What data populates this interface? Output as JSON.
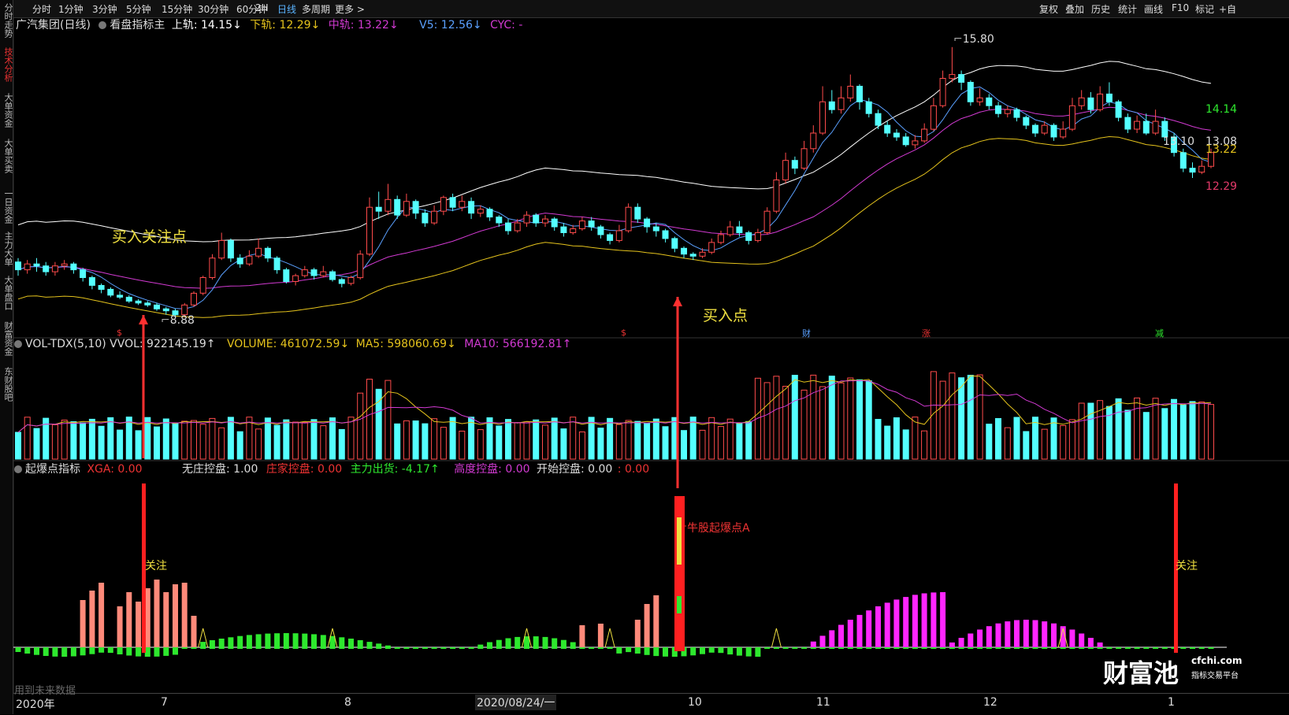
{
  "left_tabs": [
    {
      "label": "分时走势",
      "active": false
    },
    {
      "label": "技术分析",
      "active": true
    },
    {
      "label": "大单资金",
      "active": false
    },
    {
      "label": "大单买卖",
      "active": false
    },
    {
      "label": "一日资金",
      "active": false
    },
    {
      "label": "主力大单",
      "active": false
    },
    {
      "label": "大单盘口",
      "active": false
    },
    {
      "label": "财富资金",
      "active": false
    },
    {
      "label": "东财股吧",
      "active": false
    }
  ],
  "toolbar": {
    "periods": [
      "分时",
      "1分钟",
      "3分钟",
      "5分钟",
      "15分钟",
      "30分钟",
      "60分钟",
      "2H",
      "日线",
      "多周期",
      "更多 >"
    ],
    "active_period": "日线",
    "right": [
      "复权",
      "叠加",
      "历史",
      "统计",
      "画线",
      "F10",
      "标记",
      "+自"
    ]
  },
  "main_header": {
    "stock": "广汽集团(日线)",
    "indicator": "看盘指标主",
    "upper": "上轨: 14.15↓",
    "lower": "下轨: 12.29↓",
    "mid": "中轨: 13.22↓",
    "v5": "V5: 12.56↓",
    "cyc": "CYC: -",
    "colors": {
      "upper": "#ffffff",
      "lower": "#e5c31c",
      "mid": "#d23ad2",
      "v5": "#5aa0ff",
      "cyc": "#d23ad2"
    }
  },
  "vol_header": {
    "name": "VOL-TDX(5,10)",
    "vvol": "VVOL: 922145.19↑",
    "volume": "VOLUME: 461072.59↓",
    "ma5": "MA5: 598060.69↓",
    "ma10": "MA10: 566192.81↑"
  },
  "ind_header": {
    "name": "起爆点指标",
    "xga": "XGA: 0.00",
    "wz": "无庄控盘: 1.00",
    "zj": "庄家控盘: 0.00",
    "zlch": "主力出货: -4.17↑",
    "gd": "高度控盘: 0.00",
    "ks": "开始控盘: 0.00",
    "extra": ": 0.00"
  },
  "annotations": {
    "buy_watch": "买入关注点",
    "buy_point": "买入点",
    "bull_start": "牛股起爆点A",
    "watch1": "关注",
    "watch2": "关注"
  },
  "price_tags": {
    "high": "15.80",
    "low": "8.88",
    "right_upper": "14.14",
    "right_mid1": "13.08",
    "right_mid2": "13.22",
    "right_last": "13.10",
    "right_lower": "12.29"
  },
  "event_marks": [
    "$",
    "$",
    "财",
    "涨",
    "减"
  ],
  "months": [
    "2020年",
    "7",
    "8",
    "10",
    "11",
    "12",
    "1"
  ],
  "cursor_date": "2020/08/24/一",
  "future_note": "用到未来数据",
  "watermark": {
    "brand": "财富池",
    "site": "cfchi.com",
    "sub": "指标交易平台"
  },
  "chart_data": {
    "type": "candlestick",
    "candles": [
      [
        10.3,
        10.1,
        10.4,
        9.95
      ],
      [
        10.1,
        10.25,
        10.35,
        10.0
      ],
      [
        10.25,
        10.2,
        10.4,
        10.05
      ],
      [
        10.2,
        10.05,
        10.3,
        9.95
      ],
      [
        10.05,
        10.2,
        10.3,
        9.95
      ],
      [
        10.2,
        10.25,
        10.35,
        10.1
      ],
      [
        10.25,
        10.1,
        10.3,
        10.0
      ],
      [
        10.1,
        9.9,
        10.15,
        9.8
      ],
      [
        9.9,
        9.7,
        9.95,
        9.6
      ],
      [
        9.7,
        9.6,
        9.75,
        9.5
      ],
      [
        9.6,
        9.45,
        9.65,
        9.4
      ],
      [
        9.45,
        9.4,
        9.55,
        9.35
      ],
      [
        9.4,
        9.3,
        9.45,
        9.25
      ],
      [
        9.3,
        9.25,
        9.35,
        9.2
      ],
      [
        9.25,
        9.2,
        9.3,
        9.15
      ],
      [
        9.2,
        9.1,
        9.25,
        9.05
      ],
      [
        9.1,
        9.05,
        9.15,
        8.95
      ],
      [
        9.05,
        8.95,
        9.1,
        8.88
      ],
      [
        8.95,
        9.2,
        9.25,
        8.9
      ],
      [
        9.2,
        9.5,
        9.55,
        9.15
      ],
      [
        9.5,
        9.9,
        9.95,
        9.45
      ],
      [
        9.9,
        10.4,
        10.5,
        9.85
      ],
      [
        10.4,
        10.85,
        11.05,
        10.35
      ],
      [
        10.85,
        10.4,
        10.9,
        10.3
      ],
      [
        10.4,
        10.25,
        10.5,
        10.15
      ],
      [
        10.25,
        10.45,
        10.6,
        10.2
      ],
      [
        10.45,
        10.65,
        10.9,
        10.4
      ],
      [
        10.65,
        10.4,
        10.7,
        10.3
      ],
      [
        10.4,
        10.1,
        10.45,
        10.0
      ],
      [
        10.1,
        9.8,
        10.15,
        9.75
      ],
      [
        9.8,
        9.95,
        10.0,
        9.7
      ],
      [
        9.95,
        10.1,
        10.2,
        9.9
      ],
      [
        10.1,
        9.95,
        10.15,
        9.85
      ],
      [
        9.95,
        10.05,
        10.2,
        9.9
      ],
      [
        10.05,
        9.85,
        10.1,
        9.8
      ],
      [
        9.85,
        9.75,
        9.9,
        9.65
      ],
      [
        9.75,
        9.9,
        9.95,
        9.7
      ],
      [
        9.9,
        10.5,
        10.6,
        9.85
      ],
      [
        10.5,
        11.7,
        11.95,
        10.45
      ],
      [
        11.7,
        11.6,
        12.1,
        11.4
      ],
      [
        11.6,
        11.9,
        12.3,
        11.5
      ],
      [
        11.9,
        11.5,
        12.0,
        11.4
      ],
      [
        11.5,
        11.85,
        12.05,
        11.45
      ],
      [
        11.85,
        11.55,
        11.9,
        11.4
      ],
      [
        11.55,
        11.3,
        11.65,
        11.2
      ],
      [
        11.3,
        11.6,
        11.75,
        11.25
      ],
      [
        11.6,
        11.95,
        12.0,
        11.5
      ],
      [
        11.95,
        11.7,
        12.05,
        11.6
      ],
      [
        11.7,
        11.85,
        12.0,
        11.6
      ],
      [
        11.85,
        11.55,
        11.95,
        11.4
      ],
      [
        11.55,
        11.65,
        11.75,
        11.45
      ],
      [
        11.65,
        11.45,
        11.7,
        11.35
      ],
      [
        11.45,
        11.3,
        11.5,
        11.2
      ],
      [
        11.3,
        11.1,
        11.4,
        11.0
      ],
      [
        11.1,
        11.3,
        11.4,
        11.05
      ],
      [
        11.3,
        11.5,
        11.6,
        11.2
      ],
      [
        11.5,
        11.3,
        11.55,
        11.2
      ],
      [
        11.3,
        11.4,
        11.5,
        11.2
      ],
      [
        11.4,
        11.2,
        11.45,
        11.1
      ],
      [
        11.2,
        11.05,
        11.3,
        10.95
      ],
      [
        11.05,
        11.15,
        11.25,
        11.0
      ],
      [
        11.15,
        11.35,
        11.45,
        11.1
      ],
      [
        11.35,
        11.2,
        11.45,
        11.1
      ],
      [
        11.2,
        11.0,
        11.25,
        10.9
      ],
      [
        11.0,
        10.85,
        11.05,
        10.75
      ],
      [
        10.85,
        11.1,
        11.25,
        10.8
      ],
      [
        11.1,
        11.7,
        11.8,
        11.05
      ],
      [
        11.7,
        11.4,
        11.8,
        11.3
      ],
      [
        11.4,
        11.2,
        11.45,
        11.05
      ],
      [
        11.2,
        11.1,
        11.3,
        10.95
      ],
      [
        11.1,
        10.9,
        11.15,
        10.8
      ],
      [
        10.9,
        10.65,
        10.95,
        10.55
      ],
      [
        10.65,
        10.5,
        10.7,
        10.4
      ],
      [
        10.5,
        10.45,
        10.55,
        10.35
      ],
      [
        10.45,
        10.55,
        10.65,
        10.4
      ],
      [
        10.55,
        10.8,
        10.9,
        10.5
      ],
      [
        10.8,
        11.0,
        11.1,
        10.75
      ],
      [
        11.0,
        11.2,
        11.35,
        10.95
      ],
      [
        11.2,
        11.05,
        11.35,
        10.95
      ],
      [
        11.05,
        10.85,
        11.1,
        10.75
      ],
      [
        10.85,
        11.05,
        11.15,
        10.8
      ],
      [
        11.05,
        11.6,
        11.7,
        11.0
      ],
      [
        11.6,
        12.4,
        12.6,
        11.55
      ],
      [
        12.4,
        12.9,
        13.1,
        12.3
      ],
      [
        12.9,
        12.7,
        13.0,
        12.55
      ],
      [
        12.7,
        13.2,
        13.4,
        12.65
      ],
      [
        13.2,
        13.6,
        13.8,
        13.1
      ],
      [
        13.6,
        14.4,
        14.8,
        13.55
      ],
      [
        14.4,
        14.2,
        14.7,
        14.1
      ],
      [
        14.2,
        14.5,
        14.8,
        14.1
      ],
      [
        14.5,
        14.8,
        15.1,
        14.4
      ],
      [
        14.8,
        14.4,
        14.85,
        14.2
      ],
      [
        14.4,
        14.1,
        14.5,
        14.0
      ],
      [
        14.1,
        13.8,
        14.2,
        13.7
      ],
      [
        13.8,
        13.6,
        13.9,
        13.5
      ],
      [
        13.6,
        13.5,
        13.7,
        13.4
      ],
      [
        13.5,
        13.3,
        13.6,
        13.25
      ],
      [
        13.3,
        13.4,
        13.55,
        13.2
      ],
      [
        13.4,
        13.7,
        13.85,
        13.35
      ],
      [
        13.7,
        14.3,
        14.5,
        13.65
      ],
      [
        14.3,
        15.0,
        15.2,
        14.25
      ],
      [
        15.0,
        15.1,
        15.8,
        14.9
      ],
      [
        15.1,
        14.9,
        15.2,
        14.7
      ],
      [
        14.9,
        14.4,
        14.95,
        14.3
      ],
      [
        14.4,
        14.5,
        14.75,
        14.3
      ],
      [
        14.5,
        14.3,
        14.6,
        14.2
      ],
      [
        14.3,
        14.1,
        14.4,
        14.0
      ],
      [
        14.1,
        14.2,
        14.3,
        14.0
      ],
      [
        14.2,
        14.0,
        14.25,
        13.9
      ],
      [
        14.0,
        13.8,
        14.05,
        13.7
      ],
      [
        13.8,
        13.6,
        13.85,
        13.5
      ],
      [
        13.6,
        13.8,
        13.9,
        13.55
      ],
      [
        13.8,
        13.5,
        13.85,
        13.4
      ],
      [
        13.5,
        13.7,
        13.9,
        13.45
      ],
      [
        13.7,
        14.3,
        14.5,
        13.65
      ],
      [
        14.3,
        14.5,
        14.7,
        14.2
      ],
      [
        14.5,
        14.2,
        14.65,
        14.1
      ],
      [
        14.2,
        14.6,
        14.8,
        14.15
      ],
      [
        14.6,
        14.4,
        14.9,
        14.3
      ],
      [
        14.4,
        14.0,
        14.45,
        13.9
      ],
      [
        14.0,
        13.7,
        14.1,
        13.6
      ],
      [
        13.7,
        13.9,
        14.05,
        13.6
      ],
      [
        13.9,
        13.6,
        14.1,
        13.55
      ],
      [
        13.6,
        13.9,
        14.2,
        13.55
      ],
      [
        13.9,
        13.5,
        14.0,
        13.4
      ],
      [
        13.5,
        13.1,
        13.6,
        13.0
      ],
      [
        13.1,
        12.7,
        13.2,
        12.6
      ],
      [
        12.7,
        12.6,
        12.85,
        12.45
      ],
      [
        12.6,
        12.75,
        12.9,
        12.55
      ],
      [
        12.75,
        13.1,
        13.2,
        12.7
      ]
    ],
    "y_range": [
      8.5,
      16.2
    ]
  }
}
